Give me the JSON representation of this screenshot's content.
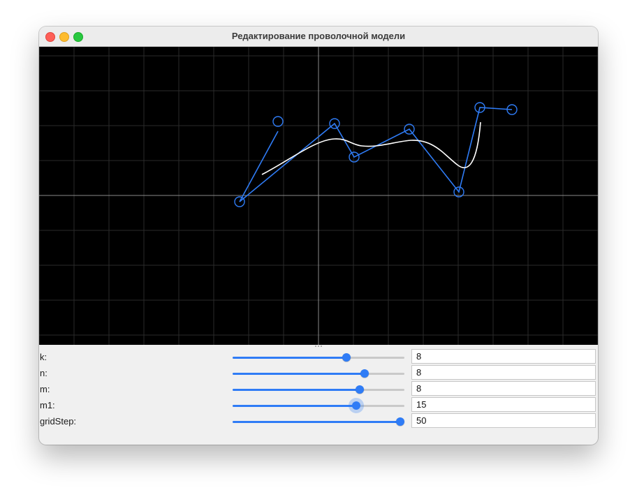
{
  "window": {
    "title": "Редактирование проволочной модели"
  },
  "canvas": {
    "background": "#000000",
    "grid_color": "#2a2a2a",
    "axis_color": "#8a8a8a",
    "control_polyline_color": "#2f7cf6",
    "curve_color": "#ffffff",
    "grid_step": 50
  },
  "controls": [
    {
      "label": "k:",
      "value": "8",
      "slider_fraction": 0.67
    },
    {
      "label": "n:",
      "value": "8",
      "slider_fraction": 0.78
    },
    {
      "label": "m:",
      "value": "8",
      "slider_fraction": 0.75
    },
    {
      "label": "m1:",
      "value": "15",
      "slider_fraction": 0.73
    },
    {
      "label": "gridStep:",
      "value": "50",
      "slider_fraction": 1.0
    }
  ]
}
